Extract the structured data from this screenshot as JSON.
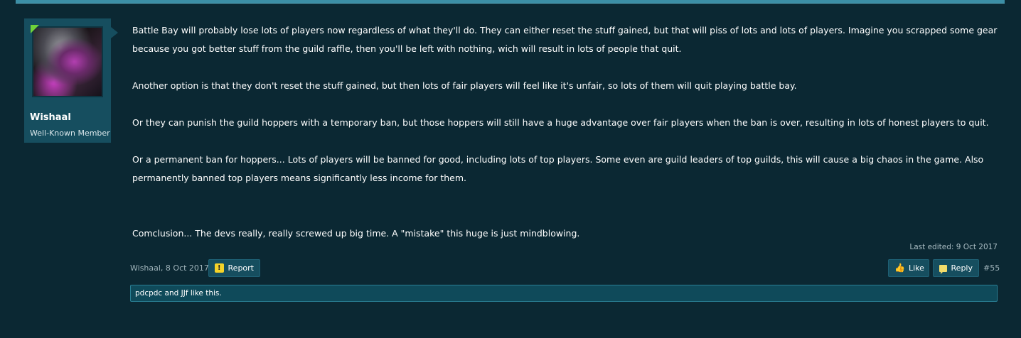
{
  "user": {
    "name": "Wishaal",
    "title": "Well-Known Member"
  },
  "post": {
    "paragraphs": [
      "Battle Bay will probably lose lots of players now regardless of what they'll do. They can either reset the stuff gained, but that will piss of lots and lots of players. Imagine you scrapped some gear because you got better stuff from the guild raffle, then you'll be left with nothing, wich will result in lots of people that quit.",
      "Another option is that they don't reset the stuff gained, but then lots of fair players will feel like it's unfair, so lots of them will quit playing battle bay.",
      "Or they can punish the guild hoppers with a temporary ban, but those hoppers will still have a huge advantage over fair players when the ban is over, resulting in lots of honest players to quit.",
      "Or a permanent ban for hoppers... Lots of players will be banned for good, including lots of top players. Some even are guild leaders of top guilds, this will cause a big chaos in the game. Also permanently banned top players means significantly less income for them.",
      "Comclusion... The devs really, really screwed up big time. A \"mistake\" this huge is just mindblowing."
    ],
    "last_edited": "Last edited: 9 Oct 2017",
    "author_date": "Wishaal, 8 Oct 2017",
    "number": "#55",
    "likes_text": "pdcpdc and JJf like this."
  },
  "actions": {
    "report_label": "Report",
    "like_label": "Like",
    "reply_label": "Reply"
  },
  "icons": {
    "report": "warning-icon",
    "like": "thumbs-up-icon",
    "reply": "speech-bubble-icon"
  },
  "colors": {
    "background": "#0b2833",
    "panel": "#164e5f",
    "online": "#6fd23a"
  }
}
